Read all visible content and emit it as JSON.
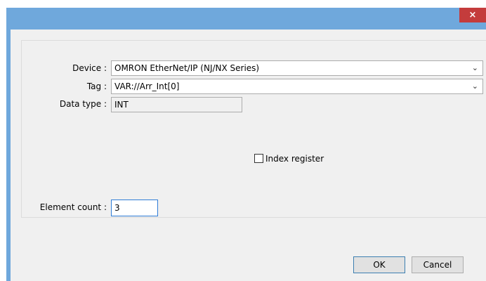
{
  "titlebar": {
    "close_glyph": "×"
  },
  "form": {
    "device_label": "Device :",
    "device_value": "OMRON EtherNet/IP (NJ/NX Series)",
    "tag_label": "Tag :",
    "tag_value": "VAR://Arr_Int[0]",
    "datatype_label": "Data type :",
    "datatype_value": "INT",
    "index_register_label": "Index register",
    "index_register_checked": false,
    "element_count_label": "Element count :",
    "element_count_value": "3"
  },
  "buttons": {
    "ok_label": "OK",
    "cancel_label": "Cancel"
  },
  "icons": {
    "close": "close-icon",
    "dropdown": "chevron-down-icon"
  },
  "colors": {
    "titlebar": "#6fa8dc",
    "close_button": "#c43c3c",
    "client_bg": "#f0f0f0",
    "input_focus_border": "#2f7cd6"
  }
}
